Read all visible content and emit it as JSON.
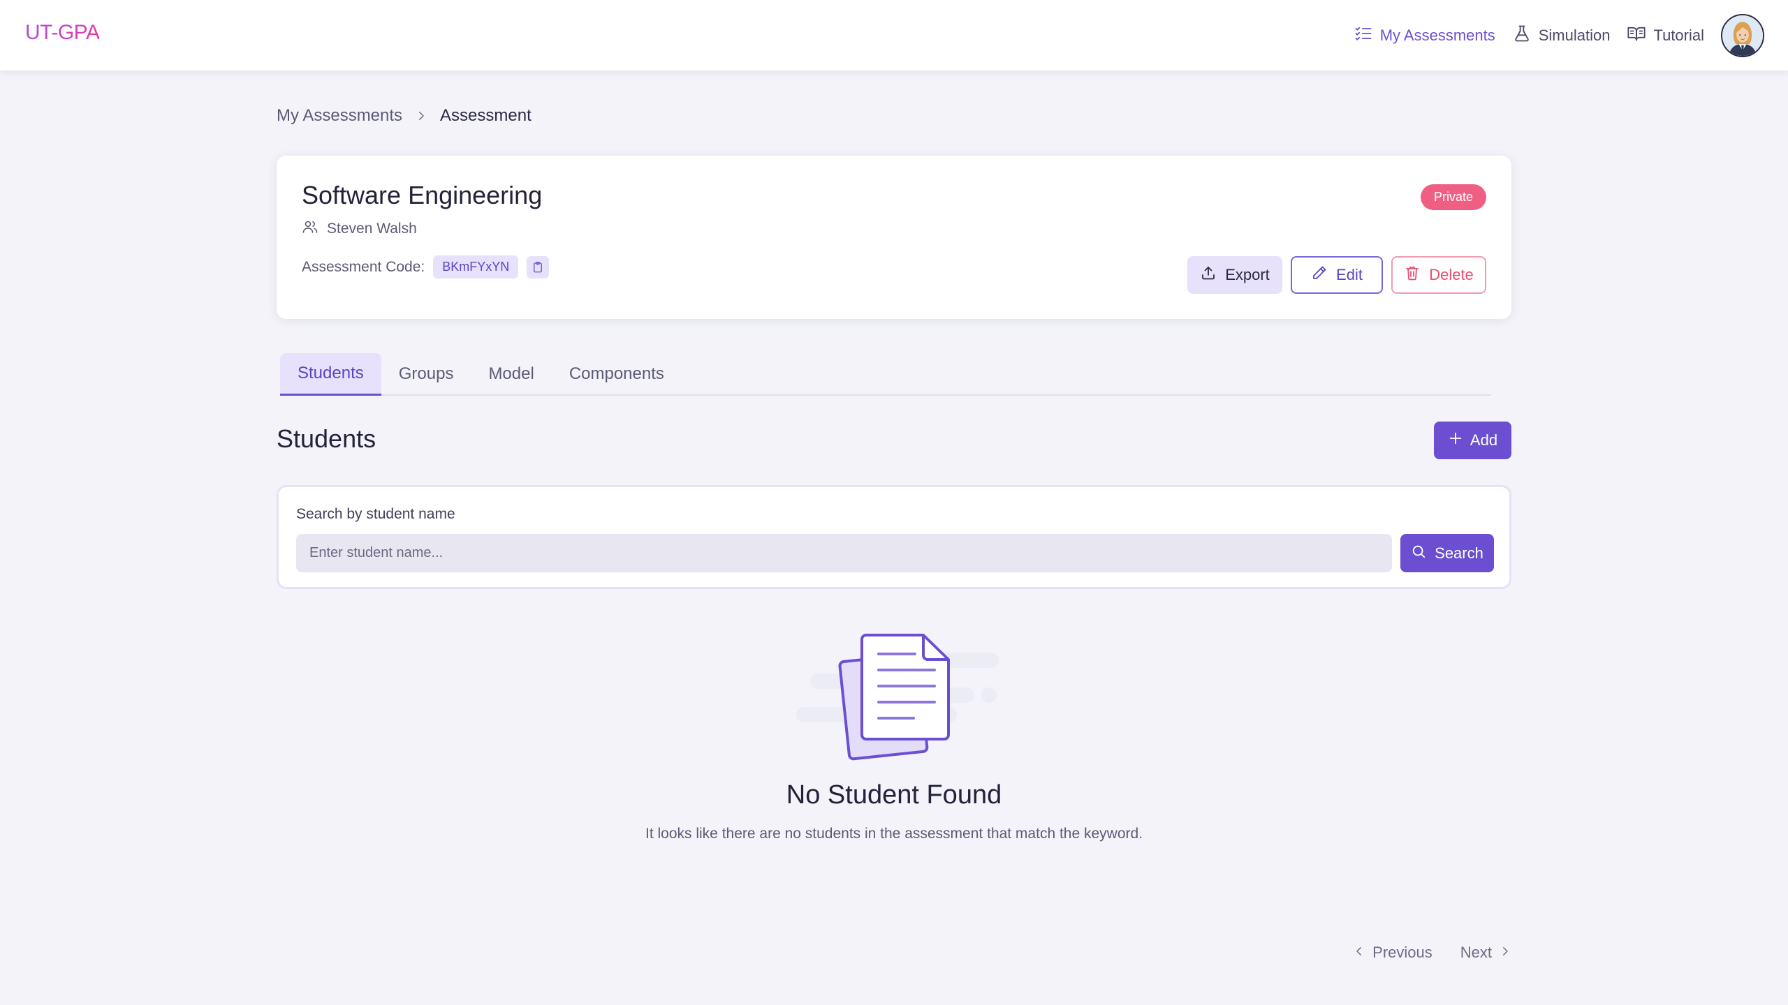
{
  "navbar": {
    "brand": "UT-GPA",
    "links": [
      {
        "label": "My Assessments",
        "icon": "list-check-icon",
        "active": true
      },
      {
        "label": "Simulation",
        "icon": "flask-icon",
        "active": false
      },
      {
        "label": "Tutorial",
        "icon": "book-open-icon",
        "active": false
      }
    ]
  },
  "breadcrumb": {
    "parent": "My Assessments",
    "current": "Assessment"
  },
  "assessment": {
    "title": "Software Engineering",
    "owner": "Steven Walsh",
    "code_label": "Assessment Code:",
    "code": "BKmFYxYN",
    "visibility": "Private",
    "actions": {
      "export": "Export",
      "edit": "Edit",
      "delete": "Delete"
    }
  },
  "tabs": [
    {
      "label": "Students",
      "active": true
    },
    {
      "label": "Groups",
      "active": false
    },
    {
      "label": "Model",
      "active": false
    },
    {
      "label": "Components",
      "active": false
    }
  ],
  "students": {
    "title": "Students",
    "add_label": "Add",
    "search": {
      "label": "Search by student name",
      "placeholder": "Enter student name...",
      "value": "",
      "button": "Search"
    },
    "empty": {
      "title": "No Student Found",
      "description": "It looks like there are no students in the assessment that match the keyword."
    }
  },
  "pagination": {
    "previous": "Previous",
    "next": "Next"
  },
  "colors": {
    "accent": "#6c4fd0",
    "accent_light": "#e7e1fb",
    "danger": "#ea4c71",
    "private_badge": "#ef5f84",
    "background": "#f3f3f9"
  }
}
